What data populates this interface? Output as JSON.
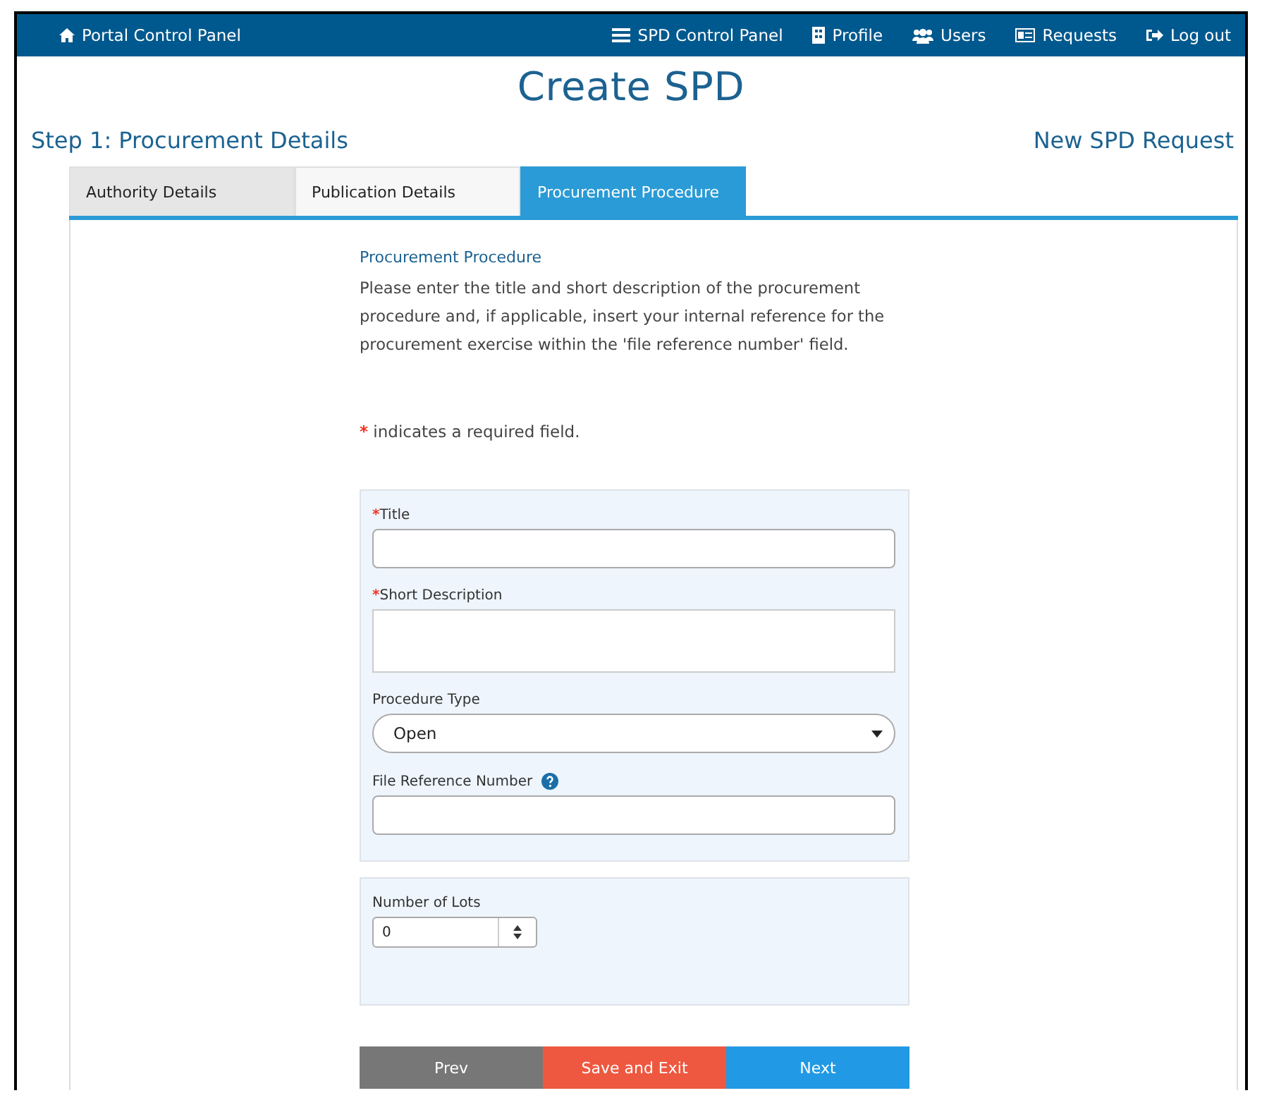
{
  "navbar": {
    "brand": {
      "label": "Portal Control Panel",
      "kind": "home"
    },
    "items": [
      {
        "label": "SPD Control Panel",
        "kind": "list"
      },
      {
        "label": "Profile",
        "kind": "building"
      },
      {
        "label": "Users",
        "kind": "users"
      },
      {
        "label": "Requests",
        "kind": "card"
      },
      {
        "label": "Log out",
        "kind": "logout"
      }
    ]
  },
  "page_title": "Create SPD",
  "step": "Step 1: Procurement Details",
  "request_type": "New SPD Request",
  "tabs": [
    {
      "label": "Authority Details",
      "selected": false,
      "visited": true
    },
    {
      "label": "Publication Details",
      "selected": false,
      "visited": false
    },
    {
      "label": "Procurement Procedure",
      "selected": true,
      "visited": false
    }
  ],
  "section": {
    "heading": "Procurement Procedure",
    "intro": "Please enter the title and short description of the procurement procedure and, if applicable, insert your internal reference for the procurement exercise within the 'file reference number' field.",
    "legend": {
      "mark": "*",
      "text": "indicates a required field."
    }
  },
  "groups": [
    {
      "fields": [
        {
          "kind": "text",
          "label": "Title",
          "required": true,
          "help": false
        },
        {
          "kind": "textarea",
          "label": "Short Description",
          "required": true,
          "help": false
        },
        {
          "kind": "select",
          "label": "Procedure Type",
          "required": false,
          "help": false,
          "value": "Open"
        },
        {
          "kind": "text",
          "label": "File Reference Number",
          "required": false,
          "help": true
        }
      ]
    },
    {
      "fields": [
        {
          "kind": "number",
          "label": "Number of Lots",
          "required": false,
          "help": false,
          "value": "0"
        }
      ]
    }
  ],
  "buttons": [
    {
      "label": "Prev",
      "kind": "back"
    },
    {
      "label": "Save and Exit",
      "kind": "save"
    },
    {
      "label": "Next",
      "kind": "next"
    }
  ]
}
